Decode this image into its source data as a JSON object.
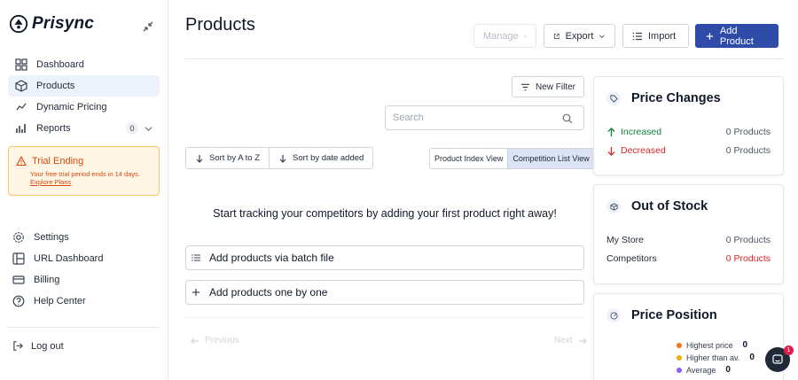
{
  "brand": {
    "name": "Prisync"
  },
  "nav": {
    "items": [
      {
        "label": "Dashboard"
      },
      {
        "label": "Products"
      },
      {
        "label": "Dynamic Pricing"
      },
      {
        "label": "Reports",
        "badge": "0"
      }
    ]
  },
  "trial": {
    "title": "Trial Ending",
    "message": "Your free trial period ends in 14 days.",
    "link": "Explore Plans"
  },
  "nav2": {
    "items": [
      {
        "label": "Settings"
      },
      {
        "label": "URL Dashboard"
      },
      {
        "label": "Billing"
      },
      {
        "label": "Help Center"
      }
    ]
  },
  "logout": {
    "label": "Log out"
  },
  "header": {
    "title": "Products",
    "manage": "Manage",
    "export": "Export",
    "import": "Import",
    "add_product": "Add Product"
  },
  "filters": {
    "new_filter": "New Filter",
    "search_placeholder": "Search",
    "sort_az": "Sort by A to Z",
    "sort_date": "Sort by date added",
    "view_index": "Product Index View",
    "view_competition": "Competition List View"
  },
  "empty": {
    "message": "Start tracking your competitors by adding your first product right away!",
    "batch": "Add products via batch file",
    "one_by_one": "Add products one by one"
  },
  "pager": {
    "previous": "Previous",
    "next": "Next"
  },
  "price_changes": {
    "title": "Price Changes",
    "increased_label": "Increased",
    "increased_value": "0 Products",
    "decreased_label": "Decreased",
    "decreased_value": "0 Products"
  },
  "out_of_stock": {
    "title": "Out of Stock",
    "my_store_label": "My Store",
    "my_store_value": "0 Products",
    "competitors_label": "Competitors",
    "competitors_value": "0 Products"
  },
  "price_position": {
    "title": "Price Position",
    "legend": [
      {
        "label": "Highest price",
        "value": "0",
        "color": "#f97316"
      },
      {
        "label": "Higher than av.",
        "value": "0",
        "color": "#eab308"
      },
      {
        "label": "Average",
        "value": "0",
        "color": "#8b5cf6"
      }
    ]
  },
  "chat": {
    "notification_count": "1"
  },
  "colors": {
    "primary": "#2f4ba8",
    "warning": "#d9480f",
    "success": "#15803d",
    "danger": "#dc2626"
  }
}
